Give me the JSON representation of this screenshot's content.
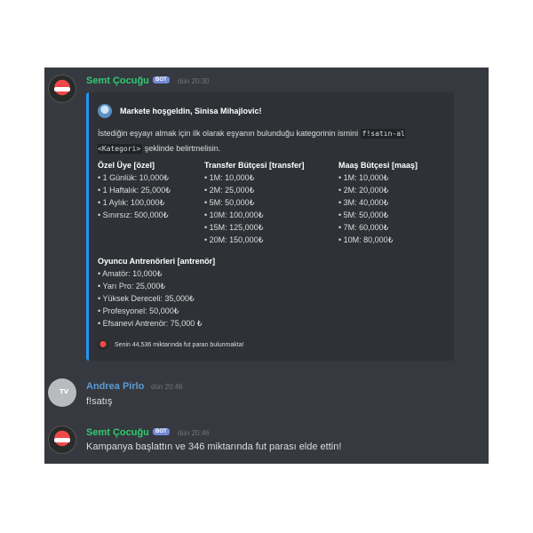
{
  "messages": {
    "m1": {
      "username": "Semt Çocuğu",
      "bot_tag": "BOT",
      "timestamp": "dün 20:30"
    },
    "m2": {
      "username": "Andrea Pirlo",
      "timestamp": "dün 20:46",
      "text": "f!satış",
      "avatar_text": "TV"
    },
    "m3": {
      "username": "Semt Çocuğu",
      "bot_tag": "BOT",
      "timestamp": "dün 20:46",
      "text": "Kampanya başlattın ve 346 miktarında fut parası elde ettin!"
    }
  },
  "embed": {
    "title": "Markete hoşgeldin, Sinisa Mihajlovic!",
    "desc_part1": "İstediğin eşyayı almak için ilk olarak eşyanın bulunduğu kategorinin ismini",
    "desc_code": "f!satın-al <Kategori>",
    "desc_part2": "şeklinde belirtmelisin.",
    "fields": {
      "ozel": {
        "title": "Özel Üye [özel]",
        "items": [
          "• 1 Günlük: 10,000₺",
          "• 1 Haftalık: 25,000₺",
          "• 1 Aylık: 100,000₺",
          "• Sınırsız: 500,000₺"
        ]
      },
      "transfer": {
        "title": "Transfer Bütçesi [transfer]",
        "items": [
          "• 1M: 10,000₺",
          "• 2M: 25,000₺",
          "• 5M: 50,000₺",
          "• 10M: 100,000₺",
          "• 15M: 125,000₺",
          "• 20M: 150,000₺"
        ]
      },
      "maas": {
        "title": "Maaş Bütçesi [maaş]",
        "items": [
          "• 1M: 10,000₺",
          "• 2M: 20,000₺",
          "• 3M: 40,000₺",
          "• 5M: 50,000₺",
          "• 7M: 60,000₺",
          "• 10M: 80,000₺"
        ]
      },
      "antrenor": {
        "title": "Oyuncu Antrenörleri [antrenör]",
        "items": [
          "• Amatör: 10,000₺",
          "• Yarı Pro: 25,000₺",
          "• Yüksek Dereceli: 35,000₺",
          "• Profesyonel: 50,000₺",
          "• Efsanevi Antrenör: 75,000 ₺"
        ]
      }
    },
    "footer": "Senin 44,536 miktarında fut paran bulunmakta!"
  },
  "colors": {
    "background": "#36393f",
    "embed_bg": "#2f3136",
    "embed_bar": "#2196f3",
    "bot_username": "#2ecc71",
    "user_username": "#5b9bd5",
    "bot_tag": "#7289da"
  }
}
